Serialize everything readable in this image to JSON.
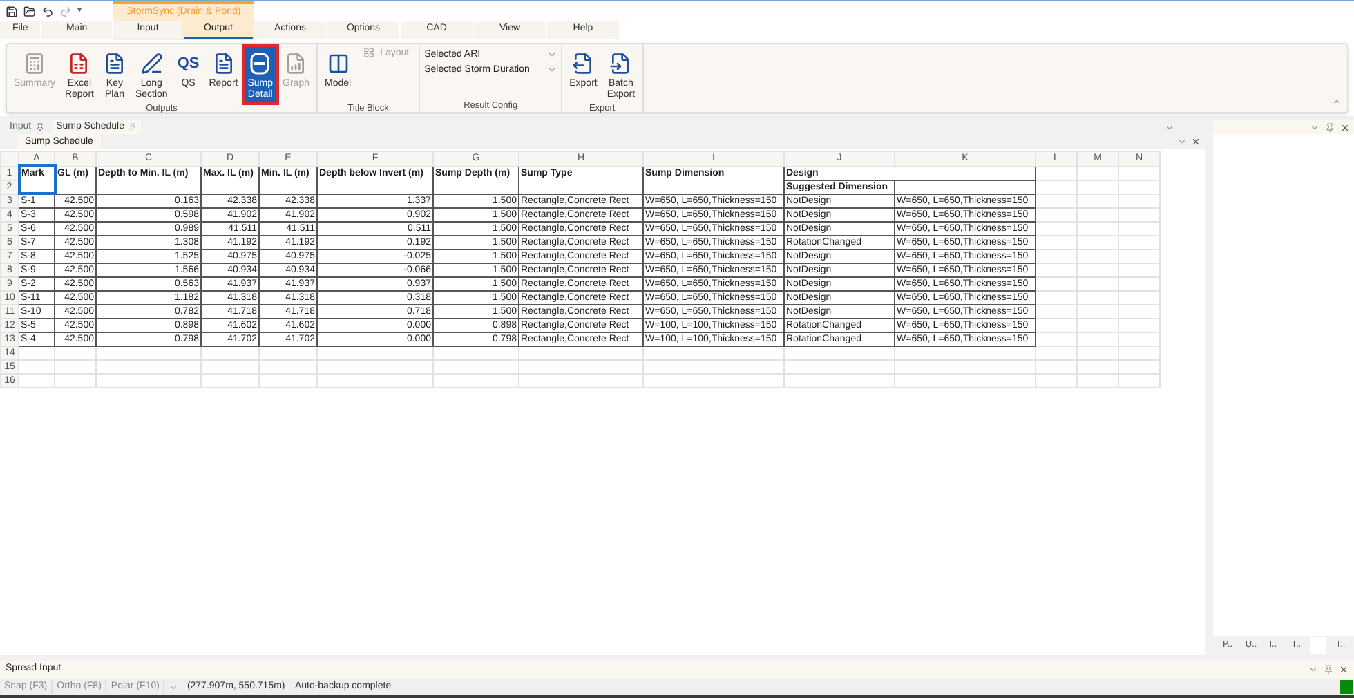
{
  "quick_access": {
    "more": "▾"
  },
  "contextual_tab": {
    "title": "StormSync (Drain & Pond)"
  },
  "menu_tabs": [
    {
      "label": "File",
      "selected": false
    },
    {
      "label": "Main",
      "selected": false
    },
    {
      "label": "Input",
      "selected": false
    },
    {
      "label": "Output",
      "selected": true
    },
    {
      "label": "Actions",
      "selected": false
    },
    {
      "label": "Options",
      "selected": false
    },
    {
      "label": "CAD",
      "selected": false
    },
    {
      "label": "View",
      "selected": false
    },
    {
      "label": "Help",
      "selected": false
    }
  ],
  "ribbon": {
    "groups": [
      {
        "caption": "Outputs",
        "buttons": [
          {
            "label": "Summary",
            "disabled": true,
            "selected": false
          },
          {
            "label": "Excel Report",
            "disabled": false,
            "selected": false
          },
          {
            "label": "Key Plan",
            "disabled": false,
            "selected": false
          },
          {
            "label": "Long Section",
            "disabled": false,
            "selected": false
          },
          {
            "label": "QS",
            "icon_text": "QS",
            "disabled": false,
            "selected": false
          },
          {
            "label": "Report",
            "disabled": false,
            "selected": false
          },
          {
            "label": "Sump Detail",
            "disabled": false,
            "selected": true
          },
          {
            "label": "Graph",
            "disabled": true,
            "selected": false
          }
        ]
      },
      {
        "caption": "Title Block",
        "buttons": [
          {
            "label": "Model",
            "disabled": false,
            "selected": false
          },
          {
            "label": "Layout",
            "disabled": true,
            "selected": false,
            "kind": "small"
          }
        ]
      },
      {
        "caption": "Result Config",
        "kind": "combos",
        "combos": [
          "Selected ARI",
          "Selected Storm Duration"
        ]
      },
      {
        "caption": "Export",
        "buttons": [
          {
            "label": "Export",
            "disabled": false,
            "selected": false
          },
          {
            "label": "Batch Export",
            "disabled": false,
            "selected": false
          }
        ]
      }
    ]
  },
  "doc_tabs": [
    {
      "label": "Input",
      "selected": false
    },
    {
      "label": "Sump Schedule",
      "selected": true
    }
  ],
  "sheet_tab": "Sump Schedule",
  "sheet": {
    "columns": [
      "A",
      "B",
      "C",
      "D",
      "E",
      "F",
      "G",
      "H",
      "I",
      "J",
      "K",
      "L",
      "M",
      "N"
    ],
    "header_row_numbers": [
      "1",
      "2"
    ],
    "headers": [
      {
        "text": "Mark",
        "selected": true
      },
      {
        "text": "GL (m)",
        "selected": false
      },
      {
        "text": "Depth to Min. IL (m)",
        "selected": false
      },
      {
        "text": "Max. IL (m)",
        "selected": false
      },
      {
        "text": "Min. IL (m)",
        "selected": false
      },
      {
        "text": "Depth below Invert (m)",
        "selected": false
      },
      {
        "text": "Sump Depth (m)",
        "selected": false
      },
      {
        "text": "Sump Type",
        "selected": false
      },
      {
        "text": "Sump Dimension",
        "selected": false
      }
    ],
    "design_group": "Design",
    "sub_header": "Suggested Dimension",
    "rows": [
      {
        "number": "3",
        "cells": [
          "S-1",
          "42.500",
          "0.163",
          "42.338",
          "42.338",
          "1.337",
          "1.500",
          "Rectangle,Concrete Rect",
          "W=650, L=650,Thickness=150",
          "NotDesign",
          "W=650, L=650,Thickness=150"
        ]
      },
      {
        "number": "4",
        "cells": [
          "S-3",
          "42.500",
          "0.598",
          "41.902",
          "41.902",
          "0.902",
          "1.500",
          "Rectangle,Concrete Rect",
          "W=650, L=650,Thickness=150",
          "NotDesign",
          "W=650, L=650,Thickness=150"
        ]
      },
      {
        "number": "5",
        "cells": [
          "S-6",
          "42.500",
          "0.989",
          "41.511",
          "41.511",
          "0.511",
          "1.500",
          "Rectangle,Concrete Rect",
          "W=650, L=650,Thickness=150",
          "NotDesign",
          "W=650, L=650,Thickness=150"
        ]
      },
      {
        "number": "6",
        "cells": [
          "S-7",
          "42.500",
          "1.308",
          "41.192",
          "41.192",
          "0.192",
          "1.500",
          "Rectangle,Concrete Rect",
          "W=650, L=650,Thickness=150",
          "RotationChanged",
          "W=650, L=650,Thickness=150"
        ]
      },
      {
        "number": "7",
        "cells": [
          "S-8",
          "42.500",
          "1.525",
          "40.975",
          "40.975",
          "-0.025",
          "1.500",
          "Rectangle,Concrete Rect",
          "W=650, L=650,Thickness=150",
          "NotDesign",
          "W=650, L=650,Thickness=150"
        ]
      },
      {
        "number": "8",
        "cells": [
          "S-9",
          "42.500",
          "1.566",
          "40.934",
          "40.934",
          "-0.066",
          "1.500",
          "Rectangle,Concrete Rect",
          "W=650, L=650,Thickness=150",
          "NotDesign",
          "W=650, L=650,Thickness=150"
        ]
      },
      {
        "number": "9",
        "cells": [
          "S-2",
          "42.500",
          "0.563",
          "41.937",
          "41.937",
          "0.937",
          "1.500",
          "Rectangle,Concrete Rect",
          "W=650, L=650,Thickness=150",
          "NotDesign",
          "W=650, L=650,Thickness=150"
        ]
      },
      {
        "number": "10",
        "cells": [
          "S-11",
          "42.500",
          "1.182",
          "41.318",
          "41.318",
          "0.318",
          "1.500",
          "Rectangle,Concrete Rect",
          "W=650, L=650,Thickness=150",
          "NotDesign",
          "W=650, L=650,Thickness=150"
        ]
      },
      {
        "number": "11",
        "cells": [
          "S-10",
          "42.500",
          "0.782",
          "41.718",
          "41.718",
          "0.718",
          "1.500",
          "Rectangle,Concrete Rect",
          "W=650, L=650,Thickness=150",
          "NotDesign",
          "W=650, L=650,Thickness=150"
        ]
      },
      {
        "number": "12",
        "cells": [
          "S-5",
          "42.500",
          "0.898",
          "41.602",
          "41.602",
          "0.000",
          "0.898",
          "Rectangle,Concrete Rect",
          "W=100, L=100,Thickness=150",
          "RotationChanged",
          "W=650, L=650,Thickness=150"
        ]
      },
      {
        "number": "13",
        "cells": [
          "S-4",
          "42.500",
          "0.798",
          "41.702",
          "41.702",
          "0.000",
          "0.798",
          "Rectangle,Concrete Rect",
          "W=100, L=100,Thickness=150",
          "RotationChanged",
          "W=650, L=650,Thickness=150"
        ]
      }
    ],
    "empty_rows": [
      "14",
      "15",
      "16"
    ]
  },
  "side_panel": {
    "tabs": [
      {
        "label": "P..",
        "selected": false
      },
      {
        "label": "U..",
        "selected": false
      },
      {
        "label": "I..",
        "selected": false
      },
      {
        "label": "T..",
        "selected": false
      },
      {
        "selected": true
      },
      {
        "label": "T..",
        "selected": false
      }
    ]
  },
  "bottom_panel": {
    "title": "Spread Input"
  },
  "status_bar": {
    "toggles": [
      "Snap (F3)",
      "Ortho (F8)",
      "Polar (F10)"
    ],
    "coordinates": "(277.907m, 550.715m)",
    "message": "Auto-backup complete"
  }
}
